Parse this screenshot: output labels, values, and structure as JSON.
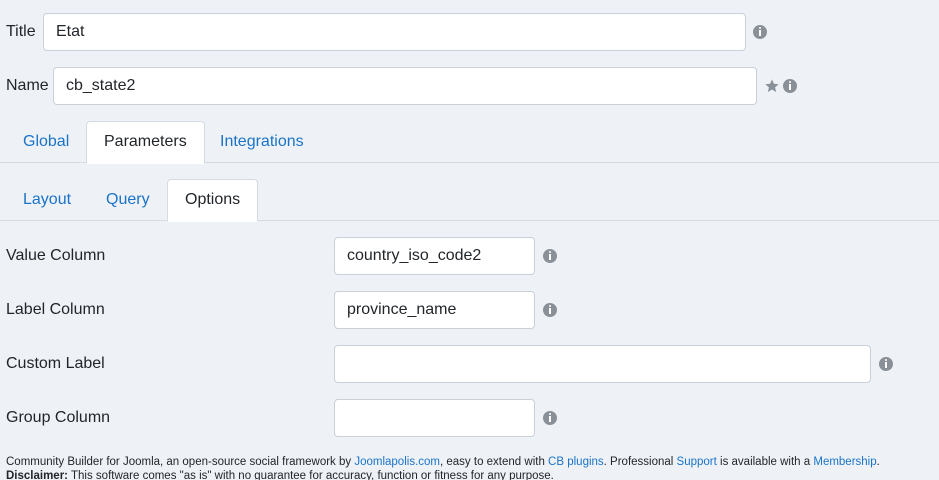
{
  "fields": {
    "title": {
      "label": "Title",
      "value": "Etat"
    },
    "name": {
      "label": "Name",
      "value": "cb_state2"
    }
  },
  "main_tabs": [
    {
      "label": "Global"
    },
    {
      "label": "Parameters"
    },
    {
      "label": "Integrations"
    }
  ],
  "sub_tabs": [
    {
      "label": "Layout"
    },
    {
      "label": "Query"
    },
    {
      "label": "Options"
    }
  ],
  "options": {
    "value_column": {
      "label": "Value Column",
      "value": "country_iso_code2"
    },
    "label_column": {
      "label": "Label Column",
      "value": "province_name"
    },
    "custom_label": {
      "label": "Custom Label",
      "value": ""
    },
    "group_column": {
      "label": "Group Column",
      "value": ""
    }
  },
  "footer": {
    "text1": "Community Builder for Joomla, an open-source social framework by ",
    "link1": "Joomlapolis.com",
    "text2": ", easy to extend with ",
    "link2": "CB plugins",
    "text3": ". Professional ",
    "link3": "Support",
    "text4": " is available with a ",
    "link4": "Membership",
    "text5": ".",
    "disclaimer_label": "Disclaimer:",
    "disclaimer_text": " This software comes \"as is\" with no guarantee for accuracy, function or fitness for any purpose."
  },
  "colors": {
    "background": "#eef2f6",
    "link": "#1a73c9",
    "icon": "#8a9097"
  }
}
